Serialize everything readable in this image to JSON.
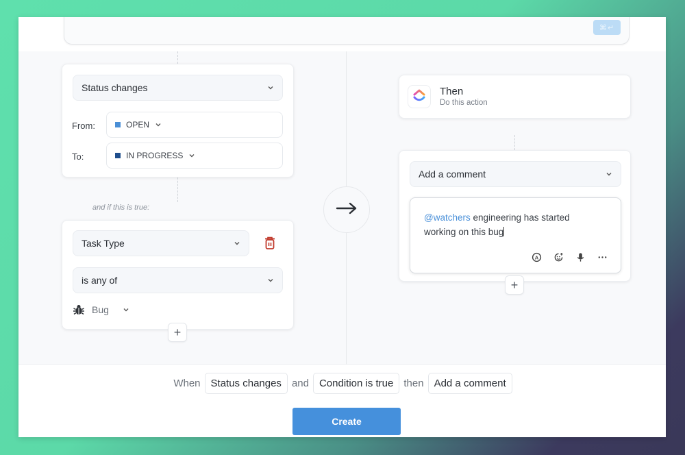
{
  "editor": {
    "shortcut_hint": "⌘↵"
  },
  "trigger": {
    "event_select": "Status changes",
    "from_label": "From:",
    "from_value": "OPEN",
    "from_color": "#4a8fd6",
    "to_label": "To:",
    "to_value": "IN PROGRESS",
    "to_color": "#1f4e8c"
  },
  "condition_note": "and if this is true:",
  "condition": {
    "field_select": "Task Type",
    "operator_select": "is any of",
    "value": "Bug",
    "delete_color": "#c0392b"
  },
  "action_header": {
    "title": "Then",
    "subtitle": "Do this action"
  },
  "action": {
    "type_select": "Add a comment",
    "comment_mention": "@watchers",
    "comment_text": " engineering has started working on this bug"
  },
  "add_button_label": "+",
  "summary": {
    "when": "When",
    "trigger_chip": "Status changes",
    "and": "and",
    "condition_chip": "Condition is true",
    "then": "then",
    "action_chip": "Add a comment"
  },
  "create_button": "Create",
  "colors": {
    "accent": "#4590dc",
    "mention": "#4a90d9"
  }
}
